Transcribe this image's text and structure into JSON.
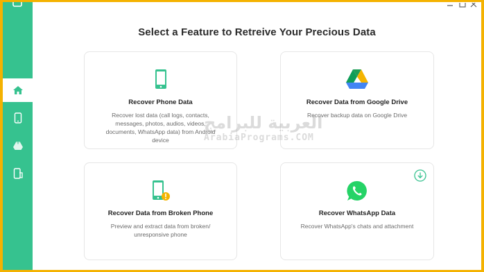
{
  "page": {
    "title": "Select a Feature to Retreive Your Precious Data"
  },
  "sidebar": {
    "items": [
      {
        "name": "home",
        "icon": "home-icon",
        "active": true
      },
      {
        "name": "phone",
        "icon": "phone-icon",
        "active": false
      },
      {
        "name": "drive",
        "icon": "drive-icon",
        "active": false
      },
      {
        "name": "broken-phone",
        "icon": "broken-phone-icon",
        "active": false
      }
    ]
  },
  "cards": {
    "phone": {
      "title": "Recover Phone Data",
      "desc": "Recover lost data (call logs, contacts, messages, photos, audios, videos, documents, WhatsApp data) from Android device"
    },
    "drive": {
      "title": "Recover Data from Google Drive",
      "desc": "Recover backup data on Google Drive"
    },
    "broken": {
      "title": "Recover Data from Broken Phone",
      "desc": "Preview and extract data from broken/ unresponsive phone"
    },
    "whatsapp": {
      "title": "Recover WhatsApp Data",
      "desc": "Recover WhatsApp's chats and attachment"
    }
  },
  "watermark": {
    "arabic": "العربية للبرامج",
    "latin": "ArabiaPrograms.COM"
  },
  "colors": {
    "accent": "#36c28f",
    "frame": "#f4b200",
    "whatsapp": "#25d366"
  }
}
